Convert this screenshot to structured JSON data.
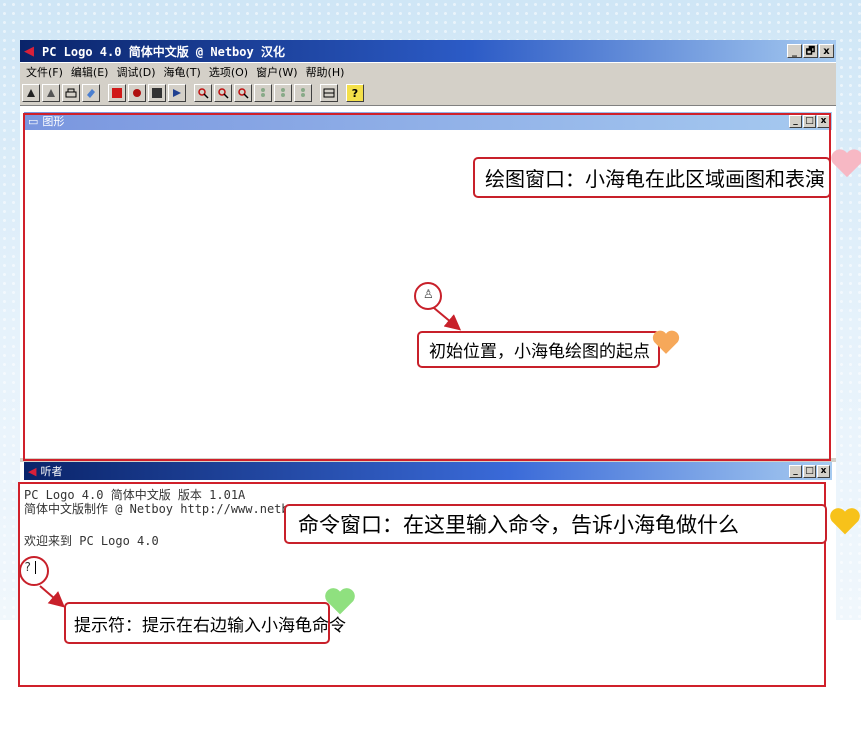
{
  "window": {
    "title": "PC Logo 4.0 简体中文版 @ Netboy 汉化",
    "buttons": [
      "_",
      "🗗",
      "x"
    ]
  },
  "menu": [
    "文件(F)",
    "编辑(E)",
    "调试(D)",
    "海龟(T)",
    "选项(O)",
    "窗户(W)",
    "帮助(H)"
  ],
  "toolbar_icons": [
    "turtle-a-icon",
    "turtle-b-icon",
    "printer-icon",
    "eraser-icon",
    "stop-icon",
    "bug-icon",
    "grid-icon",
    "step-icon",
    "zoom-in-icon",
    "zoom-out-icon",
    "zoom-icon",
    "traffic-light-1-icon",
    "traffic-light-2-icon",
    "traffic-light-3-icon",
    "panel-icon",
    "help-icon"
  ],
  "graphics_window": {
    "title": "图形"
  },
  "listener_window": {
    "title": "听者"
  },
  "listener_lines": [
    "PC Logo 4.0 简体中文版  版本  1.01A",
    "简体中文版制作  @ Netboy  http://www.netboy365.com",
    "欢迎来到 PC Logo 4.0",
    "?"
  ],
  "annotations": {
    "drawing_window": "绘图窗口：小海龟在此区域画图和表演",
    "start_position": "初始位置，小海龟绘图的起点",
    "command_window": "命令窗口：在这里输入命令，告诉小海龟做什么",
    "prompt": "提示符：提示在右边输入小海龟命令"
  },
  "colors": {
    "callout_border": "#c8202a",
    "heart_pink": "#f7b8c4",
    "heart_orange": "#f6a85a",
    "heart_yellow": "#f7c21a",
    "heart_green": "#8fe07f"
  }
}
